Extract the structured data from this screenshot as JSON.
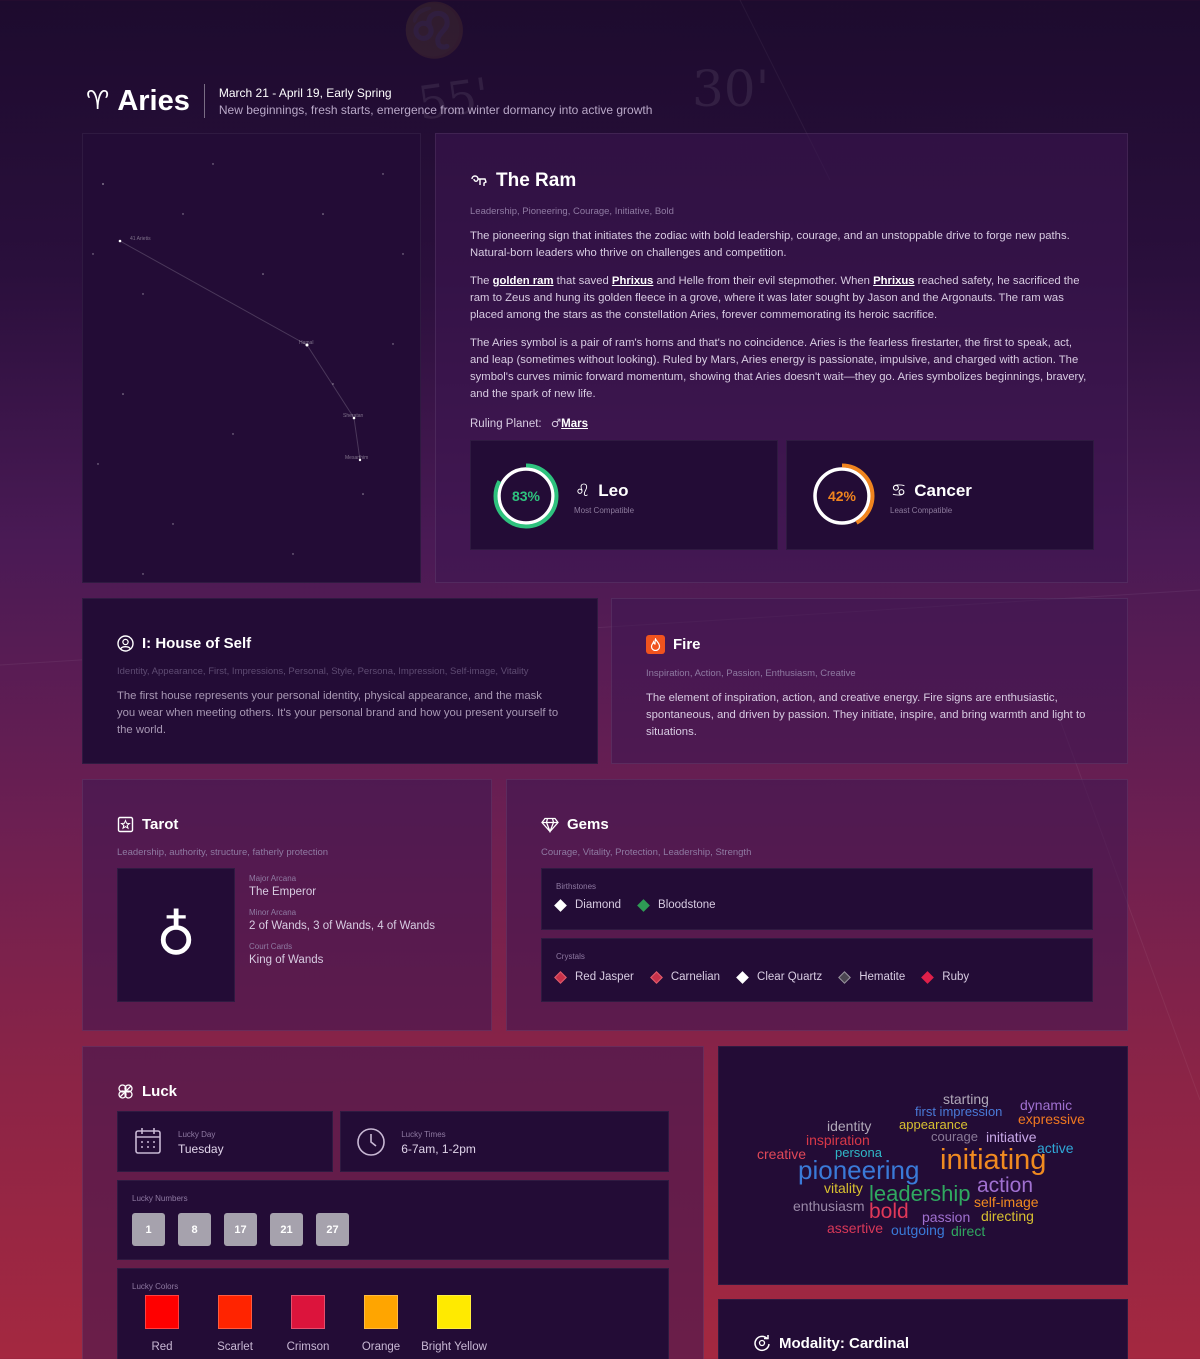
{
  "header": {
    "symbol": "♈",
    "title": "Aries",
    "dates": "March 21 - April 19, Early Spring",
    "subtitle": "New beginnings, fresh starts, emergence from winter dormancy into active growth"
  },
  "background": {
    "deco1": "♌",
    "deco2": "55'",
    "deco3": "30'"
  },
  "constellation": {
    "stars": [
      "Mesarthim",
      "Sheratan",
      "Hamal",
      "41 Arietis"
    ]
  },
  "ram": {
    "title": "The Ram",
    "tags": "Leadership, Pioneering, Courage, Initiative, Bold",
    "p1": "The pioneering sign that initiates the zodiac with bold leadership, courage, and an unstoppable drive to forge new paths. Natural-born leaders who thrive on challenges and competition.",
    "p2": {
      "a": "The ",
      "l1": "golden ram",
      "b": " that saved ",
      "l2": "Phrixus",
      "c": " and Helle from their evil stepmother. When ",
      "l3": "Phrixus",
      "d": " reached safety, he sacrificed the ram to Zeus and hung its golden fleece in a grove, where it was later sought by Jason and the Argonauts. The ram was placed among the stars as the constellation Aries, forever commemorating its heroic sacrifice."
    },
    "p3": "The Aries symbol is a pair of ram's horns and that's no coincidence. Aries is the fearless firestarter, the first to speak, act, and leap (sometimes without looking). Ruled by Mars, Aries energy is passionate, impulsive, and charged with action. The symbol's curves mimic forward momentum, showing that Aries doesn't wait—they go. Aries symbolizes beginnings, bravery, and the spark of new life.",
    "ruling_label": "Ruling Planet:",
    "ruling_symbol": "♂",
    "ruling_planet": "Mars"
  },
  "compat": {
    "most": {
      "pct_value": 83,
      "pct": "83%",
      "symbol": "♌",
      "sign": "Leo",
      "label": "Most Compatible",
      "color": "#2ec27e"
    },
    "least": {
      "pct_value": 42,
      "pct": "42%",
      "symbol": "♋",
      "sign": "Cancer",
      "label": "Least Compatible",
      "color": "#f0841e"
    }
  },
  "house": {
    "title": "I: House of Self",
    "tags": "Identity, Appearance, First, Impressions, Personal, Style, Persona, Impression, Self-image, Vitality",
    "text": "The first house represents your personal identity, physical appearance, and the mask you wear when meeting others. It's your personal brand and how you present yourself to the world."
  },
  "element": {
    "title": "Fire",
    "tags": "Inspiration, Action, Passion, Enthusiasm, Creative",
    "text": "The element of inspiration, action, and creative energy. Fire signs are enthusiastic, spontaneous, and driven by passion. They initiate, inspire, and bring warmth and light to situations.",
    "color": "#f0531e"
  },
  "tarot": {
    "title": "Tarot",
    "tags": "Leadership, authority, structure, fatherly protection",
    "symbol": "♁",
    "major_label": "Major Arcana",
    "major": "The Emperor",
    "minor_label": "Minor Arcana",
    "minor": "2 of Wands, 3 of Wands, 4 of Wands",
    "court_label": "Court Cards",
    "court": "King of Wands"
  },
  "gems": {
    "title": "Gems",
    "tags": "Courage, Vitality, Protection, Leadership, Strength",
    "birthstones_label": "Birthstones",
    "birthstones": [
      {
        "name": "Diamond",
        "color": "#ffffff"
      },
      {
        "name": "Bloodstone",
        "color": "#2e9b55"
      }
    ],
    "crystals_label": "Crystals",
    "crystals": [
      {
        "name": "Red Jasper",
        "color": "#c8324a"
      },
      {
        "name": "Carnelian",
        "color": "#c8324a"
      },
      {
        "name": "Clear Quartz",
        "color": "#ffffff"
      },
      {
        "name": "Hematite",
        "color": "#5a5560"
      },
      {
        "name": "Ruby",
        "color": "#e0204a"
      }
    ]
  },
  "luck": {
    "title": "Luck",
    "day_label": "Lucky Day",
    "day": "Tuesday",
    "times_label": "Lucky Times",
    "times": "6-7am, 1-2pm",
    "numbers_label": "Lucky Numbers",
    "numbers": [
      "1",
      "8",
      "17",
      "21",
      "27"
    ],
    "colors_label": "Lucky Colors",
    "colors": [
      {
        "name": "Red",
        "hex": "#ff0000"
      },
      {
        "name": "Scarlet",
        "hex": "#ff2400"
      },
      {
        "name": "Crimson",
        "hex": "#dc143c"
      },
      {
        "name": "Orange",
        "hex": "#ffa500"
      },
      {
        "name": "Bright Yellow",
        "hex": "#ffea00"
      }
    ]
  },
  "wordcloud": {
    "words": [
      {
        "text": "starting",
        "color": "#b0a8b8"
      },
      {
        "text": "dynamic",
        "color": "#a070d0"
      },
      {
        "text": "first impression",
        "color": "#4a7ad8"
      },
      {
        "text": "expressive",
        "color": "#f07820"
      },
      {
        "text": "identity",
        "color": "#b0a8b8"
      },
      {
        "text": "appearance",
        "color": "#d8c030"
      },
      {
        "text": "inspiration",
        "color": "#d83848"
      },
      {
        "text": "courage",
        "color": "#8a7a98"
      },
      {
        "text": "initiative",
        "color": "#c8a8e8"
      },
      {
        "text": "active",
        "color": "#30a8d8"
      },
      {
        "text": "creative",
        "color": "#e04858"
      },
      {
        "text": "persona",
        "color": "#30b8c8"
      },
      {
        "text": "pioneering",
        "color": "#3a7ad8"
      },
      {
        "text": "initiating",
        "color": "#f08a20"
      },
      {
        "text": "action",
        "color": "#a070d0"
      },
      {
        "text": "vitality",
        "color": "#d8c030"
      },
      {
        "text": "leadership",
        "color": "#30a860"
      },
      {
        "text": "enthusiasm",
        "color": "#9a8aa8"
      },
      {
        "text": "bold",
        "color": "#e03858"
      },
      {
        "text": "self-image",
        "color": "#f08a20"
      },
      {
        "text": "passion",
        "color": "#a070d0"
      },
      {
        "text": "directing",
        "color": "#d8c030"
      },
      {
        "text": "assertive",
        "color": "#d83858"
      },
      {
        "text": "outgoing",
        "color": "#3a7ad8"
      },
      {
        "text": "direct",
        "color": "#30a860"
      }
    ]
  },
  "modality": {
    "title": "Modality: Cardinal"
  }
}
